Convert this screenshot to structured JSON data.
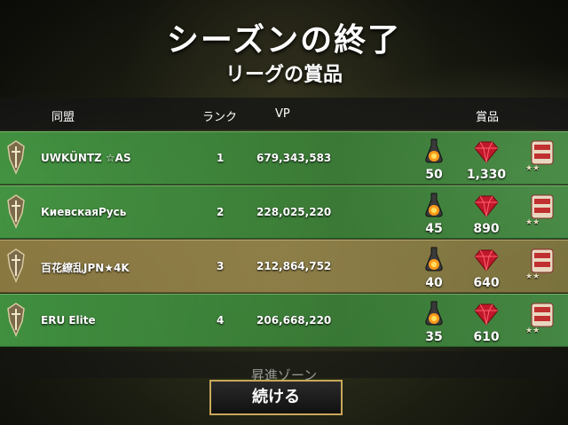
{
  "title": "シーズンの終了",
  "subtitle": "リーグの賞品",
  "header": {
    "alliance_label": "同盟",
    "rank_label": "ランク",
    "vp_label": "VP",
    "rewards_label": "賞品"
  },
  "rows": [
    {
      "alliance": "UWKÜNTZ ☆AS",
      "rank": "1",
      "vp": "679,343,583",
      "flask": "50",
      "gems": "1,330",
      "stars": "★★",
      "highlight": "green"
    },
    {
      "alliance": "КиевскаяРусь",
      "rank": "2",
      "vp": "228,025,220",
      "flask": "45",
      "gems": "890",
      "stars": "★★",
      "highlight": "green"
    },
    {
      "alliance": "百花繚乱JPN★4K",
      "rank": "3",
      "vp": "212,864,752",
      "flask": "40",
      "gems": "640",
      "stars": "★★",
      "highlight": "gold"
    },
    {
      "alliance": "ERU Elite",
      "rank": "4",
      "vp": "206,668,220",
      "flask": "35",
      "gems": "610",
      "stars": "★★",
      "highlight": "green"
    }
  ],
  "footer_partial_text": "昇進ゾーン",
  "continue_label": "続ける",
  "colors": {
    "row_green": "#4a9e4a",
    "row_gold": "#9c8a4a",
    "gem": "#c0182a",
    "button_border": "#c9a85a"
  },
  "icons": [
    "alliance-emblem-icon",
    "flask-icon",
    "gem-icon",
    "chest-icon"
  ]
}
